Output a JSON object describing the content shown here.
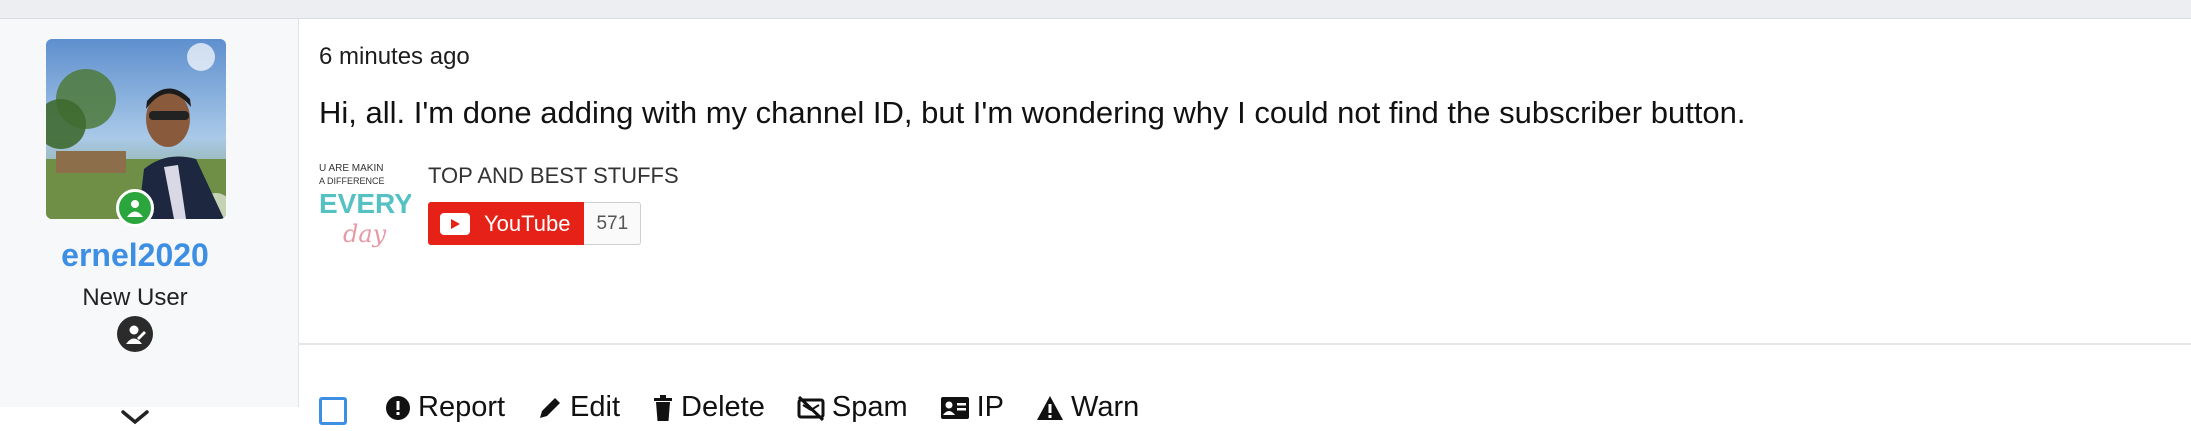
{
  "user": {
    "username": "ernel2020",
    "title": "New User",
    "online_status": "online"
  },
  "post": {
    "timestamp": "6 minutes ago",
    "message": "Hi, all. I'm done adding with my channel ID, but I'm wondering why I could not find the subscriber button.",
    "youtube": {
      "thumbnail_text": {
        "line1": "U ARE MAKIN",
        "line2": "A DIFFERENCE",
        "line3": "EVERY",
        "line4": "day"
      },
      "channel_name": "TOP AND BEST STUFFS",
      "button_label": "YouTube",
      "subscriber_count": "571"
    }
  },
  "actions": {
    "report": "Report",
    "edit": "Edit",
    "delete": "Delete",
    "spam": "Spam",
    "ip": "IP",
    "warn": "Warn"
  },
  "colors": {
    "accent": "#3d8fe3",
    "online": "#2aa63c",
    "youtube_red": "#e62117"
  }
}
